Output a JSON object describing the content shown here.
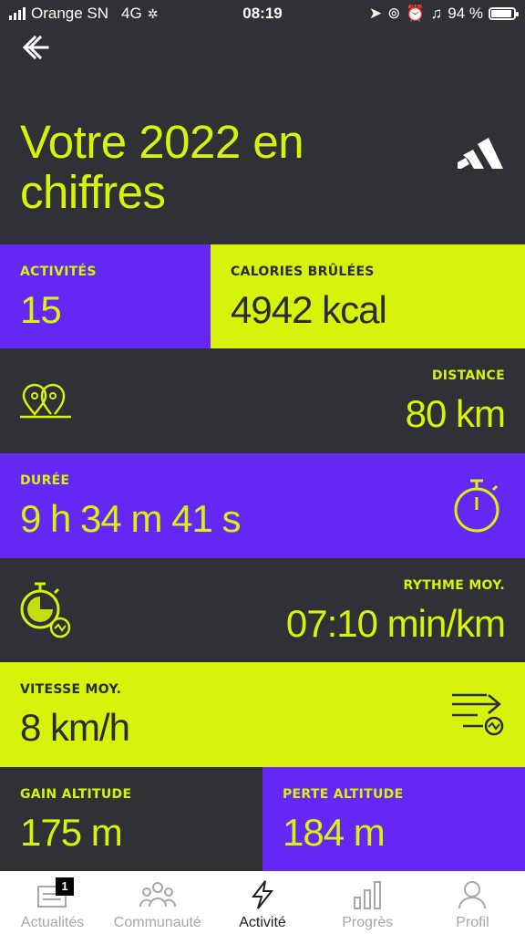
{
  "status_bar": {
    "carrier": "Orange SN",
    "network": "4G",
    "time": "08:19",
    "battery": "94 %"
  },
  "header": {
    "title": "Votre 2022 en chiffres"
  },
  "stats": {
    "activites": {
      "label": "ACTIVITÉS",
      "value": "15"
    },
    "calories": {
      "label": "CALORIES BRÛLÉES",
      "value": "4942 kcal"
    },
    "distance": {
      "label": "DISTANCE",
      "value": "80 km"
    },
    "duree": {
      "label": "DURÉE",
      "value": "9 h 34 m 41 s"
    },
    "rythme": {
      "label": "RYTHME MOY.",
      "value": "07:10 min/km"
    },
    "vitesse": {
      "label": "VITESSE MOY.",
      "value": "8 km/h"
    },
    "gain": {
      "label": "GAIN ALTITUDE",
      "value": "175 m"
    },
    "perte": {
      "label": "PERTE ALTITUDE",
      "value": "184 m"
    }
  },
  "tabbar": {
    "items": [
      {
        "label": "Actualités",
        "icon": "news-icon",
        "badge": "1"
      },
      {
        "label": "Communauté",
        "icon": "community-icon"
      },
      {
        "label": "Activité",
        "icon": "lightning-icon"
      },
      {
        "label": "Progrès",
        "icon": "bar-chart-icon"
      },
      {
        "label": "Profil",
        "icon": "person-icon"
      }
    ],
    "active": "Activité"
  },
  "colors": {
    "accent_lime": "#d7f20b",
    "accent_purple": "#6527f4",
    "background": "#2f3136"
  }
}
